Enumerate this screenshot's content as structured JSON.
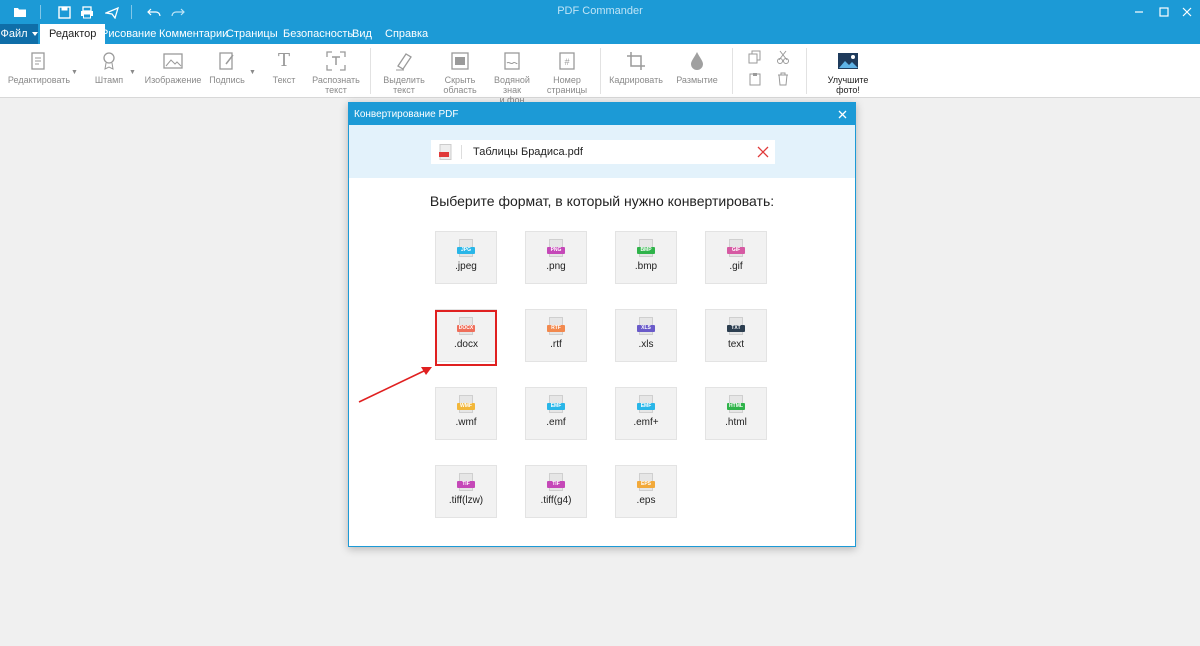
{
  "window": {
    "title": "PDF Commander"
  },
  "menu": {
    "file": "Файл",
    "tabs": [
      "Редактор",
      "Рисование",
      "Комментарии",
      "Страницы",
      "Безопасность",
      "Вид",
      "Справка"
    ]
  },
  "ribbon": {
    "edit": "Редактировать",
    "stamp": "Штамп",
    "image": "Изображение",
    "sign": "Подпись",
    "text": "Текст",
    "recognize_1": "Распознать",
    "recognize_2": "текст",
    "select_1": "Выделить",
    "select_2": "текст",
    "hide_1": "Скрыть",
    "hide_2": "область",
    "watermark_1": "Водяной знак",
    "watermark_2": "и фон",
    "pagenum_1": "Номер",
    "pagenum_2": "страницы",
    "crop": "Кадрировать",
    "blur": "Размытие",
    "enhance": "Улучшите фото!"
  },
  "dialog": {
    "title": "Конвертирование PDF",
    "file_name": "Таблицы Брадиса.pdf",
    "prompt": "Выберите формат, в который нужно конвертировать:",
    "formats": [
      {
        "badge": "JPG",
        "label": ".jpeg",
        "color": "#29b6e8"
      },
      {
        "badge": "PNG",
        "label": ".png",
        "color": "#c548b8"
      },
      {
        "badge": "BMP",
        "label": ".bmp",
        "color": "#2fb34a"
      },
      {
        "badge": "GIF",
        "label": ".gif",
        "color": "#d65aa3"
      },
      {
        "badge": "DOCX",
        "label": ".docx",
        "color": "#ef6f5b"
      },
      {
        "badge": "RTF",
        "label": ".rtf",
        "color": "#f2894e"
      },
      {
        "badge": "XLS",
        "label": ".xls",
        "color": "#6a5bc9"
      },
      {
        "badge": "TXT",
        "label": "text",
        "color": "#2c3e50"
      },
      {
        "badge": "WMF",
        "label": ".wmf",
        "color": "#f2b73a"
      },
      {
        "badge": "EMF",
        "label": ".emf",
        "color": "#29b6e8"
      },
      {
        "badge": "EMF",
        "label": ".emf+",
        "color": "#29b6e8"
      },
      {
        "badge": "HTML",
        "label": ".html",
        "color": "#2fb34a"
      },
      {
        "badge": "TIF",
        "label": ".tiff(lzw)",
        "color": "#c548b8"
      },
      {
        "badge": "TIF",
        "label": ".tiff(g4)",
        "color": "#c548b8"
      },
      {
        "badge": "EPS",
        "label": ".eps",
        "color": "#f2a93a"
      }
    ]
  }
}
